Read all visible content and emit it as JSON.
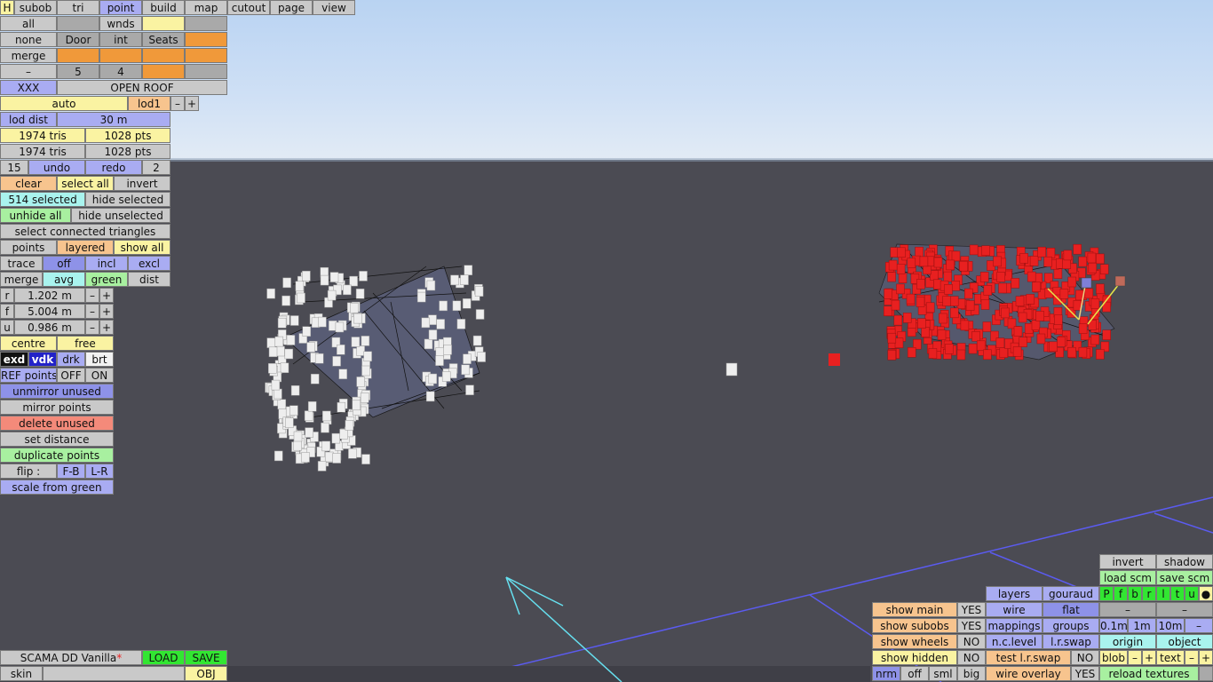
{
  "menu": {
    "h": "H",
    "subob": "subob",
    "tri": "tri",
    "point": "point",
    "build": "build",
    "map": "map",
    "cutout": "cutout",
    "page": "page",
    "view": "view"
  },
  "sel_rows": {
    "all": "all",
    "wnds": "wnds",
    "none": "none",
    "door": "Door",
    "int": "int",
    "seats": "Seats",
    "merge": "merge",
    "dash": "–",
    "five": "5",
    "four": "4",
    "xxx": "XXX",
    "open_roof": "OPEN ROOF"
  },
  "lod": {
    "auto": "auto",
    "lod1": "lod1",
    "minus": "–",
    "plus": "+",
    "lod_dist_label": "lod dist",
    "lod_dist_value": "30 m"
  },
  "stats": {
    "tris_1": "1974 tris",
    "pts_1": "1028 pts",
    "tris_2": "1974 tris",
    "pts_2": "1028 pts"
  },
  "history": {
    "count": "15",
    "undo": "undo",
    "redo": "redo",
    "redo_count": "2"
  },
  "selection": {
    "clear": "clear",
    "select_all": "select all",
    "invert": "invert",
    "selected": "514 selected",
    "hide_selected": "hide selected",
    "unhide_all": "unhide all",
    "hide_unselected": "hide unselected",
    "select_connected": "select connected triangles",
    "points": "points",
    "layered": "layered",
    "show_all": "show all",
    "trace": "trace",
    "off": "off",
    "incl": "incl",
    "excl": "excl",
    "merge": "merge",
    "avg": "avg",
    "green": "green",
    "dist": "dist"
  },
  "coords": {
    "r_label": "r",
    "r_value": "1.202 m",
    "f_label": "f",
    "f_value": "5.004 m",
    "u_label": "u",
    "u_value": "0.986 m",
    "minus": "–",
    "plus": "+"
  },
  "tools": {
    "centre": "centre",
    "free": "free",
    "exd": "exd",
    "vdk": "vdk",
    "drk": "drk",
    "brt": "brt",
    "ref_points": "REF points",
    "ref_off": "OFF",
    "ref_on": "ON",
    "unmirror_unused": "unmirror unused",
    "mirror_points": "mirror points",
    "delete_unused": "delete unused",
    "set_distance": "set distance",
    "duplicate_points": "duplicate points",
    "flip": "flip :",
    "fb": "F-B",
    "lr": "L-R",
    "scale_from_green": "scale from green"
  },
  "file": {
    "name": "SCAMA DD Vanilla",
    "modified": "*",
    "load": "LOAD",
    "save": "SAVE",
    "skin": "skin",
    "obj": "OBJ"
  },
  "right_panel": {
    "invert": "invert",
    "shadow": "shadow",
    "load_scm": "load scm",
    "save_scm": "save scm",
    "views": [
      "P",
      "f",
      "b",
      "r",
      "l",
      "t",
      "u",
      "●"
    ],
    "minus": "–",
    "layers": "layers",
    "gouraud": "gouraud",
    "wire": "wire",
    "flat": "flat",
    "show_main": "show main",
    "show_main_v": "YES",
    "show_subobs": "show subobs",
    "show_subobs_v": "YES",
    "show_wheels": "show wheels",
    "show_wheels_v": "NO",
    "show_hidden": "show hidden",
    "show_hidden_v": "NO",
    "mappings": "mappings",
    "groups": "groups",
    "n_c_level": "n.c.level",
    "l_r_swap": "l.r.swap",
    "test_lr_swap": "test l.r.swap",
    "test_lr_swap_v": "NO",
    "wire_overlay": "wire overlay",
    "wire_overlay_v": "YES",
    "grid_01": "0.1m",
    "grid_1": "1m",
    "grid_10": "10m",
    "grid_minus": "–",
    "origin": "origin",
    "object": "object",
    "blob": "blob",
    "text": "text",
    "plus": "+",
    "nrm": "nrm",
    "off": "off",
    "sml": "sml",
    "big": "big",
    "reload_textures": "reload textures"
  },
  "colors": {
    "sky": "#c7dcf4",
    "ground": "#4b4b53",
    "selected_points": "#e82020",
    "unselected_points": "#eeeeee",
    "grid_line": "#5b5bf0",
    "axis_arrow": "#66e0f0"
  }
}
